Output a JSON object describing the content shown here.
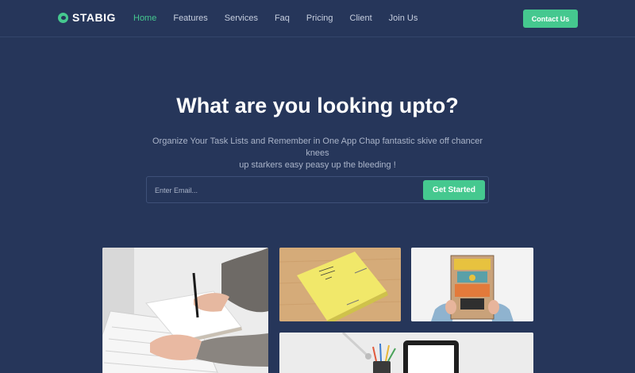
{
  "brand": {
    "name": "STABIG",
    "accent": "#45c88f",
    "background": "#26365a"
  },
  "nav": {
    "items": [
      {
        "label": "Home",
        "active": true
      },
      {
        "label": "Features"
      },
      {
        "label": "Services"
      },
      {
        "label": "Faq"
      },
      {
        "label": "Pricing"
      },
      {
        "label": "Client"
      },
      {
        "label": "Join Us"
      }
    ],
    "cta": "Contact Us"
  },
  "hero": {
    "title": "What are you looking upto?",
    "subtitle_line1": "Organize Your Task Lists and Remember in One App Chap fantastic skive off chancer knees",
    "subtitle_line2": "up starkers easy peasy up the bleeding !",
    "email_placeholder": "Enter Email...",
    "button": "Get Started"
  },
  "gallery": {
    "images": [
      {
        "subject": "hands-writing-notebook-at-keyboard"
      },
      {
        "subject": "yellow-notebook-on-wood"
      },
      {
        "subject": "whatever-you-do-do-it-good-book"
      },
      {
        "subject": "desk-with-tablet-and-pencils"
      }
    ]
  }
}
